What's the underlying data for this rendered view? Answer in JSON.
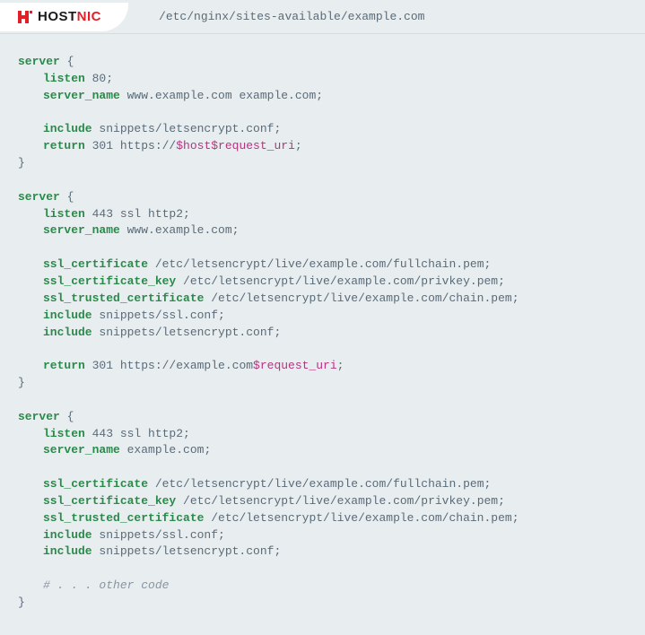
{
  "header": {
    "logo_host": "HOST",
    "logo_nic": "NIC",
    "file_path": "/etc/nginx/sites-available/example.com"
  },
  "code": {
    "block1": {
      "server": "server",
      "open": " {",
      "listen": "listen",
      "listen_val": " 80;",
      "server_name": "server_name",
      "server_name_val": " www.example.com example.com;",
      "include": "include",
      "include_val": " snippets/letsencrypt.conf;",
      "return": "return",
      "return_val1": " 301 https://",
      "return_var1": "$host",
      "return_var2": "$request_uri",
      "return_end": ";",
      "close": "}"
    },
    "block2": {
      "server": "server",
      "open": " {",
      "listen": "listen",
      "listen_val": " 443 ssl http2;",
      "server_name": "server_name",
      "server_name_val": " www.example.com;",
      "ssl_cert": "ssl_certificate",
      "ssl_cert_val": " /etc/letsencrypt/live/example.com/fullchain.pem;",
      "ssl_key": "ssl_certificate_key",
      "ssl_key_val": " /etc/letsencrypt/live/example.com/privkey.pem;",
      "ssl_trusted": "ssl_trusted_certificate",
      "ssl_trusted_val": " /etc/letsencrypt/live/example.com/chain.pem;",
      "include1": "include",
      "include1_val": " snippets/ssl.conf;",
      "include2": "include",
      "include2_val": " snippets/letsencrypt.conf;",
      "return": "return",
      "return_val1": " 301 https://example.com",
      "return_var": "$request_uri",
      "return_end": ";",
      "close": "}"
    },
    "block3": {
      "server": "server",
      "open": " {",
      "listen": "listen",
      "listen_val": " 443 ssl http2;",
      "server_name": "server_name",
      "server_name_val": " example.com;",
      "ssl_cert": "ssl_certificate",
      "ssl_cert_val": " /etc/letsencrypt/live/example.com/fullchain.pem;",
      "ssl_key": "ssl_certificate_key",
      "ssl_key_val": " /etc/letsencrypt/live/example.com/privkey.pem;",
      "ssl_trusted": "ssl_trusted_certificate",
      "ssl_trusted_val": " /etc/letsencrypt/live/example.com/chain.pem;",
      "include1": "include",
      "include1_val": " snippets/ssl.conf;",
      "include2": "include",
      "include2_val": " snippets/letsencrypt.conf;",
      "comment": "# . . . other code",
      "close": "}"
    }
  }
}
